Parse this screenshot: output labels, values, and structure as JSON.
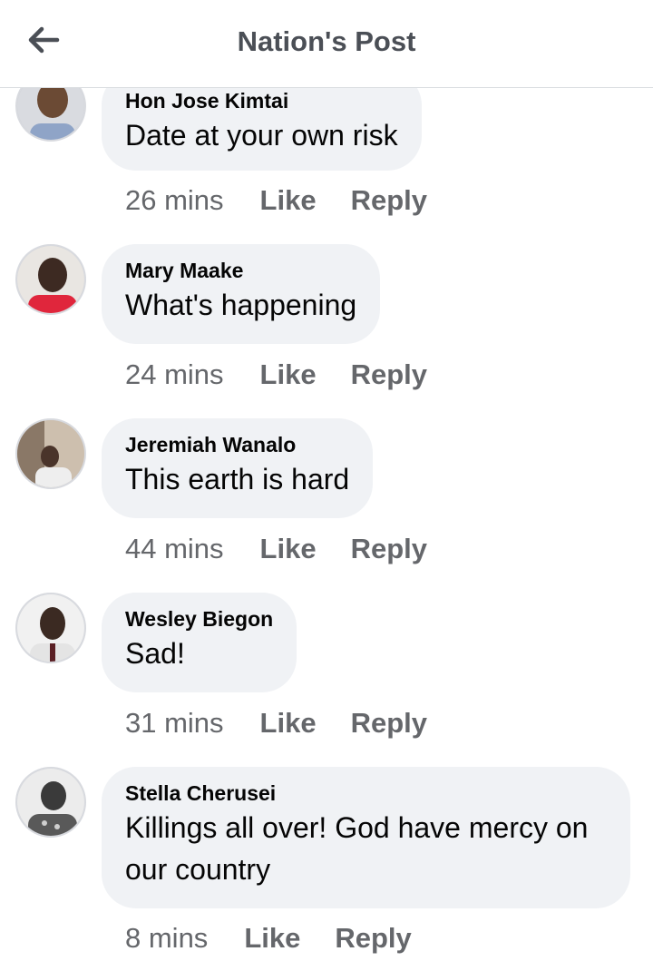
{
  "header": {
    "title": "Nation's Post",
    "back_icon": "arrow-left-icon"
  },
  "comments": [
    {
      "author": "Hon Jose Kimtai",
      "text": "Date at your own risk",
      "time": "26 mins",
      "like": "Like",
      "reply": "Reply"
    },
    {
      "author": "Mary Maake",
      "text": "What's happening",
      "time": "24 mins",
      "like": "Like",
      "reply": "Reply"
    },
    {
      "author": "Jeremiah Wanalo",
      "text": "This earth is hard",
      "time": "44 mins",
      "like": "Like",
      "reply": "Reply"
    },
    {
      "author": "Wesley Biegon",
      "text": "Sad!",
      "time": "31 mins",
      "like": "Like",
      "reply": "Reply"
    },
    {
      "author": "Stella Cherusei",
      "text": "Killings all over! God have mercy on our country",
      "time": "8 mins",
      "like": "Like",
      "reply": "Reply"
    }
  ],
  "colors": {
    "text_secondary": "#65676b",
    "bubble": "#f0f2f5",
    "title": "#4b4f56"
  }
}
